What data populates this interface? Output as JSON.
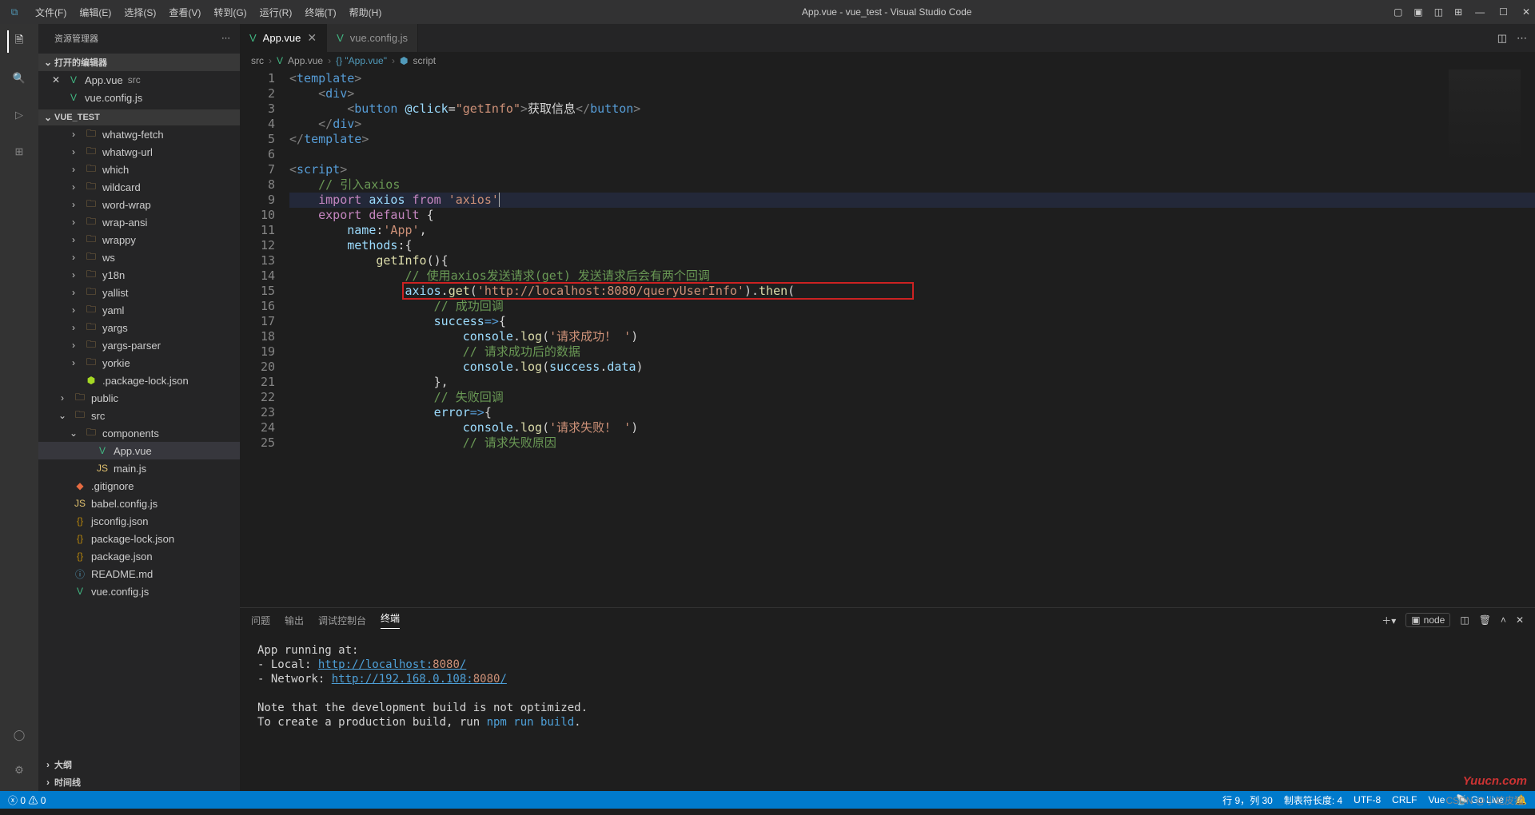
{
  "window": {
    "title": "App.vue - vue_test - Visual Studio Code"
  },
  "menu": [
    "文件(F)",
    "编辑(E)",
    "选择(S)",
    "查看(V)",
    "转到(G)",
    "运行(R)",
    "终端(T)",
    "帮助(H)"
  ],
  "explorer": {
    "title": "资源管理器",
    "openEditors": {
      "title": "打开的编辑器",
      "items": [
        {
          "icon": "vue",
          "text": "App.vue",
          "meta": "src",
          "dirty": true
        },
        {
          "icon": "vue",
          "text": "vue.config.js"
        }
      ]
    },
    "project": {
      "title": "VUE_TEST",
      "tree": [
        {
          "t": "folder",
          "d": 2,
          "ch": ">",
          "txt": "whatwg-fetch"
        },
        {
          "t": "folder",
          "d": 2,
          "ch": ">",
          "txt": "whatwg-url"
        },
        {
          "t": "folder",
          "d": 2,
          "ch": ">",
          "txt": "which"
        },
        {
          "t": "folder",
          "d": 2,
          "ch": ">",
          "txt": "wildcard"
        },
        {
          "t": "folder",
          "d": 2,
          "ch": ">",
          "txt": "word-wrap"
        },
        {
          "t": "folder",
          "d": 2,
          "ch": ">",
          "txt": "wrap-ansi"
        },
        {
          "t": "folder",
          "d": 2,
          "ch": ">",
          "txt": "wrappy"
        },
        {
          "t": "folder",
          "d": 2,
          "ch": ">",
          "txt": "ws"
        },
        {
          "t": "folder",
          "d": 2,
          "ch": ">",
          "txt": "y18n"
        },
        {
          "t": "folder",
          "d": 2,
          "ch": ">",
          "txt": "yallist"
        },
        {
          "t": "folder",
          "d": 2,
          "ch": ">",
          "txt": "yaml"
        },
        {
          "t": "folder",
          "d": 2,
          "ch": ">",
          "txt": "yargs"
        },
        {
          "t": "folder",
          "d": 2,
          "ch": ">",
          "txt": "yargs-parser"
        },
        {
          "t": "folder",
          "d": 2,
          "ch": ">",
          "txt": "yorkie"
        },
        {
          "t": "pkg",
          "d": 2,
          "txt": ".package-lock.json"
        },
        {
          "t": "folder",
          "d": 1,
          "ch": ">",
          "txt": "public"
        },
        {
          "t": "folder",
          "d": 1,
          "ch": "v",
          "txt": "src"
        },
        {
          "t": "folder",
          "d": 2,
          "ch": "v",
          "txt": "components"
        },
        {
          "t": "vue",
          "d": 3,
          "sel": true,
          "txt": "App.vue"
        },
        {
          "t": "js",
          "d": 3,
          "txt": "main.js"
        },
        {
          "t": "git",
          "d": 1,
          "txt": ".gitignore"
        },
        {
          "t": "js",
          "d": 1,
          "txt": "babel.config.js"
        },
        {
          "t": "json",
          "d": 1,
          "txt": "jsconfig.json"
        },
        {
          "t": "json",
          "d": 1,
          "txt": "package-lock.json"
        },
        {
          "t": "json",
          "d": 1,
          "txt": "package.json"
        },
        {
          "t": "md",
          "d": 1,
          "txt": "README.md"
        },
        {
          "t": "vue",
          "d": 1,
          "txt": "vue.config.js"
        }
      ]
    },
    "outline": "大纲",
    "timeline": "时间线"
  },
  "tabs": [
    {
      "icon": "vue",
      "title": "App.vue",
      "active": true,
      "dirty": false
    },
    {
      "icon": "vue",
      "title": "vue.config.js"
    }
  ],
  "breadcrumbs": [
    "src",
    "App.vue",
    "{} \"App.vue\"",
    "script"
  ],
  "code": {
    "btn_text": "获取信息",
    "app": "App",
    "axios": "axios",
    "url": "http://localhost:8080/queryUserInfo",
    "c_intro": "// 引入axios",
    "c_use": "// 使用axios发送请求(get) 发送请求后会有两个回调",
    "c_ok": "// 成功回调",
    "c_okdata": "// 请求成功后的数据",
    "c_fail": "// 失败回调",
    "c_failr": "// 请求失败原因",
    "ok": "请求成功！",
    "fail": "请求失败！"
  },
  "panel": {
    "tabs": [
      "问题",
      "输出",
      "调试控制台",
      "终端"
    ],
    "active": 3,
    "dropdown": "node",
    "term": {
      "running": "App running at:",
      "local_lbl": "- Local:   ",
      "local": "http://localhost:",
      "local_port": "8080",
      "slash": "/",
      "net_lbl": "- Network: ",
      "net": "http://192.168.0.108:",
      "net_port": "8080",
      "note1": "Note that the development build is not optimized.",
      "note2a": "To create a production build, run ",
      "note2b": "npm run build",
      "note2c": "."
    }
  },
  "status": {
    "errors": "0",
    "warnings": "0",
    "pos": "行 9，列 30",
    "tab": "制表符长度: 4",
    "enc": "UTF-8",
    "eol": "CRLF",
    "lang": "Vue",
    "live": "Go Live",
    "bell": "🔔"
  },
  "watermark": "Yuucn.com",
  "watermark2": "CSDN @小蛇皮猪"
}
